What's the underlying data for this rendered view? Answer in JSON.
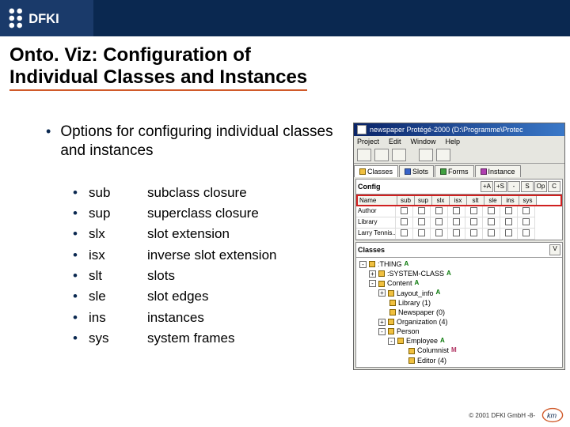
{
  "title_line1": "Onto. Viz: Configuration of",
  "title_line2": "Individual Classes and Instances",
  "bullet_main": "Options for configuring individual classes and instances",
  "options": [
    {
      "short": "sub",
      "long": "subclass closure"
    },
    {
      "short": "sup",
      "long": "superclass closure"
    },
    {
      "short": "slx",
      "long": "slot extension"
    },
    {
      "short": "isx",
      "long": "inverse slot extension"
    },
    {
      "short": "slt",
      "long": "slots"
    },
    {
      "short": "sle",
      "long": "slot edges"
    },
    {
      "short": "ins",
      "long": "instances"
    },
    {
      "short": "sys",
      "long": "system frames"
    }
  ],
  "shot": {
    "title": "newspaper  Protégé-2000   (D:\\Programme\\Protec",
    "menus": [
      "Project",
      "Edit",
      "Window",
      "Help"
    ],
    "tabs": [
      {
        "label": "Classes",
        "color": "y"
      },
      {
        "label": "Slots",
        "color": "b"
      },
      {
        "label": "Forms",
        "color": "g"
      },
      {
        "label": "Instance",
        "color": "p"
      }
    ],
    "config_label": "Config",
    "config_buttons": [
      "+A",
      "+S",
      "-",
      "S",
      "Op",
      "C"
    ],
    "grid_cols": [
      "Name",
      "sub",
      "sup",
      "slx",
      "isx",
      "slt",
      "sle",
      "ins",
      "sys"
    ],
    "grid_rows": [
      "Author",
      "Library",
      "Larry Tennis..."
    ],
    "classes_label": "Classes",
    "vbtn": "V",
    "tree": [
      {
        "indent": 0,
        "tw": "-",
        "label": ":THING",
        "mark": "A"
      },
      {
        "indent": 1,
        "tw": "+",
        "label": ":SYSTEM-CLASS",
        "mark": "A"
      },
      {
        "indent": 1,
        "tw": "-",
        "label": "Content",
        "mark": "A"
      },
      {
        "indent": 2,
        "tw": "+",
        "label": "Layout_info",
        "mark": "A"
      },
      {
        "indent": 2,
        "tw": "",
        "label": "Library  (1)",
        "mark": ""
      },
      {
        "indent": 2,
        "tw": "",
        "label": "Newspaper  (0)",
        "mark": ""
      },
      {
        "indent": 2,
        "tw": "+",
        "label": "Organization  (4)",
        "mark": ""
      },
      {
        "indent": 2,
        "tw": "-",
        "label": "Person",
        "mark": ""
      },
      {
        "indent": 3,
        "tw": "-",
        "label": "Employee",
        "mark": "A"
      },
      {
        "indent": 4,
        "tw": "",
        "label": "Columnist",
        "mark": "M"
      },
      {
        "indent": 4,
        "tw": "",
        "label": "Editor  (4)",
        "mark": ""
      }
    ]
  },
  "footer": "© 2001 DFKI GmbH   -8-"
}
